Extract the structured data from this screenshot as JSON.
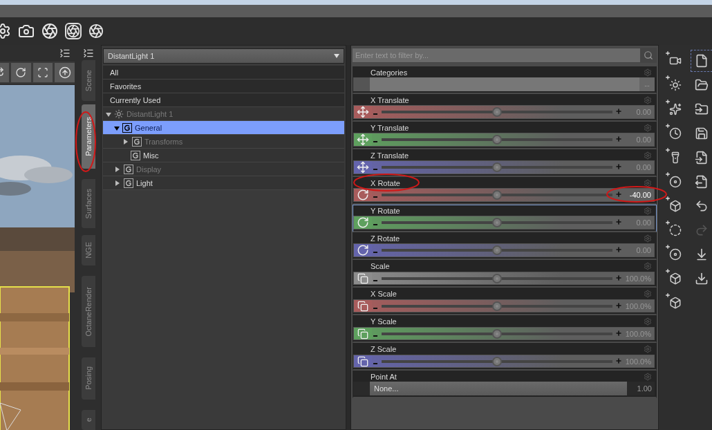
{
  "side_tabs": [
    {
      "label": "Scene",
      "selected": false
    },
    {
      "label": "Parameters",
      "selected": true
    },
    {
      "label": "Surfaces",
      "selected": false
    },
    {
      "label": "NGE",
      "selected": false
    },
    {
      "label": "OctaneRender",
      "selected": false
    },
    {
      "label": "Posing",
      "selected": false
    },
    {
      "label": "e",
      "selected": false
    }
  ],
  "node_selector": {
    "value": "DistantLight 1"
  },
  "filters": [
    {
      "label": "All",
      "selected": false
    },
    {
      "label": "Favorites",
      "selected": false
    },
    {
      "label": "Currently Used",
      "selected": false
    }
  ],
  "tree": [
    {
      "label": "DistantLight 1",
      "kind": "light",
      "expandable": true,
      "expanded": true,
      "dimmed": true,
      "selected": false,
      "children": [
        {
          "label": "General",
          "kind": "group",
          "expandable": true,
          "expanded": true,
          "dimmed": false,
          "selected": true,
          "children": [
            {
              "label": "Transforms",
              "kind": "group",
              "expandable": true,
              "expanded": false,
              "dimmed": true,
              "selected": false
            },
            {
              "label": "Misc",
              "kind": "group",
              "expandable": false,
              "dimmed": false,
              "selected": false
            }
          ]
        },
        {
          "label": "Display",
          "kind": "group",
          "expandable": true,
          "expanded": false,
          "dimmed": true,
          "selected": false
        },
        {
          "label": "Light",
          "kind": "group",
          "expandable": true,
          "expanded": false,
          "dimmed": false,
          "selected": false
        }
      ]
    }
  ],
  "filter_field": {
    "placeholder": "Enter text to filter by..."
  },
  "params": [
    {
      "kind": "categories",
      "label": "Categories",
      "button": "...",
      "selected": false
    },
    {
      "kind": "translate",
      "label": "X Translate",
      "color": "#a85c5c",
      "level": 0.5,
      "value": "0.00",
      "modified": false,
      "selected": false
    },
    {
      "kind": "translate",
      "label": "Y Translate",
      "color": "#5ea05e",
      "level": 0.5,
      "value": "0.00",
      "modified": false,
      "selected": false
    },
    {
      "kind": "translate",
      "label": "Z Translate",
      "color": "#6464ac",
      "level": 0.5,
      "value": "0.00",
      "modified": false,
      "selected": false
    },
    {
      "kind": "rotate",
      "label": "X Rotate",
      "color": "#a85c5c",
      "level": 0.5,
      "value": "-40.00",
      "modified": true,
      "selected": false
    },
    {
      "kind": "rotate",
      "label": "Y Rotate",
      "color": "#5ea05e",
      "level": 0.5,
      "value": "0.00",
      "modified": false,
      "selected": true
    },
    {
      "kind": "rotate",
      "label": "Z Rotate",
      "color": "#6464ac",
      "level": 0.5,
      "value": "0.00",
      "modified": false,
      "selected": false
    },
    {
      "kind": "scale",
      "label": "Scale",
      "color": "#8c8c8c",
      "level": 0.5,
      "value": "100.0%",
      "modified": false,
      "selected": false
    },
    {
      "kind": "scale",
      "label": "X Scale",
      "color": "#a85c5c",
      "level": 0.5,
      "value": "100.0%",
      "modified": false,
      "selected": false
    },
    {
      "kind": "scale",
      "label": "Y Scale",
      "color": "#5ea05e",
      "level": 0.5,
      "value": "100.0%",
      "modified": false,
      "selected": false
    },
    {
      "kind": "scale",
      "label": "Z Scale",
      "color": "#6464ac",
      "level": 0.5,
      "value": "100.0%",
      "modified": false,
      "selected": false
    },
    {
      "kind": "node",
      "label": "Point At",
      "value": "None...",
      "reading": "1.00",
      "selected": false
    }
  ]
}
